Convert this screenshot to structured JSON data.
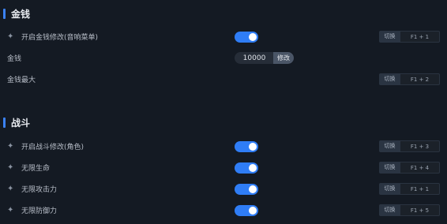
{
  "sections": [
    {
      "title": "金钱",
      "items": [
        {
          "label": "开启金钱修改(音响菜单)",
          "control": "toggle",
          "on": true,
          "icon": "sparkle-icon",
          "hotkey_label": "切换",
          "hotkey_keys": "F1 + 1"
        },
        {
          "label": "金钱",
          "control": "number",
          "value": "10000",
          "button": "修改"
        },
        {
          "label": "金钱最大",
          "control": "none",
          "hotkey_label": "切换",
          "hotkey_keys": "F1 + 2"
        }
      ]
    },
    {
      "title": "战斗",
      "items": [
        {
          "label": "开启战斗修改(角色)",
          "control": "toggle",
          "on": true,
          "icon": "sparkle-icon",
          "hotkey_label": "切换",
          "hotkey_keys": "F1 + 3"
        },
        {
          "label": "无限生命",
          "control": "toggle",
          "on": true,
          "icon": "sparkle-icon",
          "hotkey_label": "切换",
          "hotkey_keys": "F1 + 4"
        },
        {
          "label": "无限攻击力",
          "control": "toggle",
          "on": true,
          "icon": "sparkle-icon",
          "hotkey_label": "切换",
          "hotkey_keys": "F1 + 1"
        },
        {
          "label": "无限防御力",
          "control": "toggle",
          "on": true,
          "icon": "sparkle-icon",
          "hotkey_label": "切换",
          "hotkey_keys": "F1 + 5"
        }
      ]
    }
  ],
  "colors": {
    "accent": "#2f7df6",
    "background": "#141a23"
  }
}
